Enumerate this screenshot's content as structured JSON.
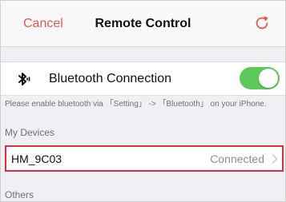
{
  "navbar": {
    "cancel_label": "Cancel",
    "title": "Remote Control",
    "refresh_icon": "refresh-icon"
  },
  "bluetooth": {
    "icon": "bluetooth-icon",
    "label": "Bluetooth Connection",
    "toggle_on": true,
    "hint": "Please enable bluetooth via 「Setting」 -> 「Bluetooth」 on your iPhone."
  },
  "sections": {
    "my_devices": "My Devices",
    "others": "Others"
  },
  "devices": [
    {
      "name": "HM_9C03",
      "status": "Connected",
      "selected": true
    }
  ],
  "colors": {
    "accent_red": "#e05a53",
    "toggle_green": "#5cc95a",
    "highlight_border": "#d8303a"
  }
}
